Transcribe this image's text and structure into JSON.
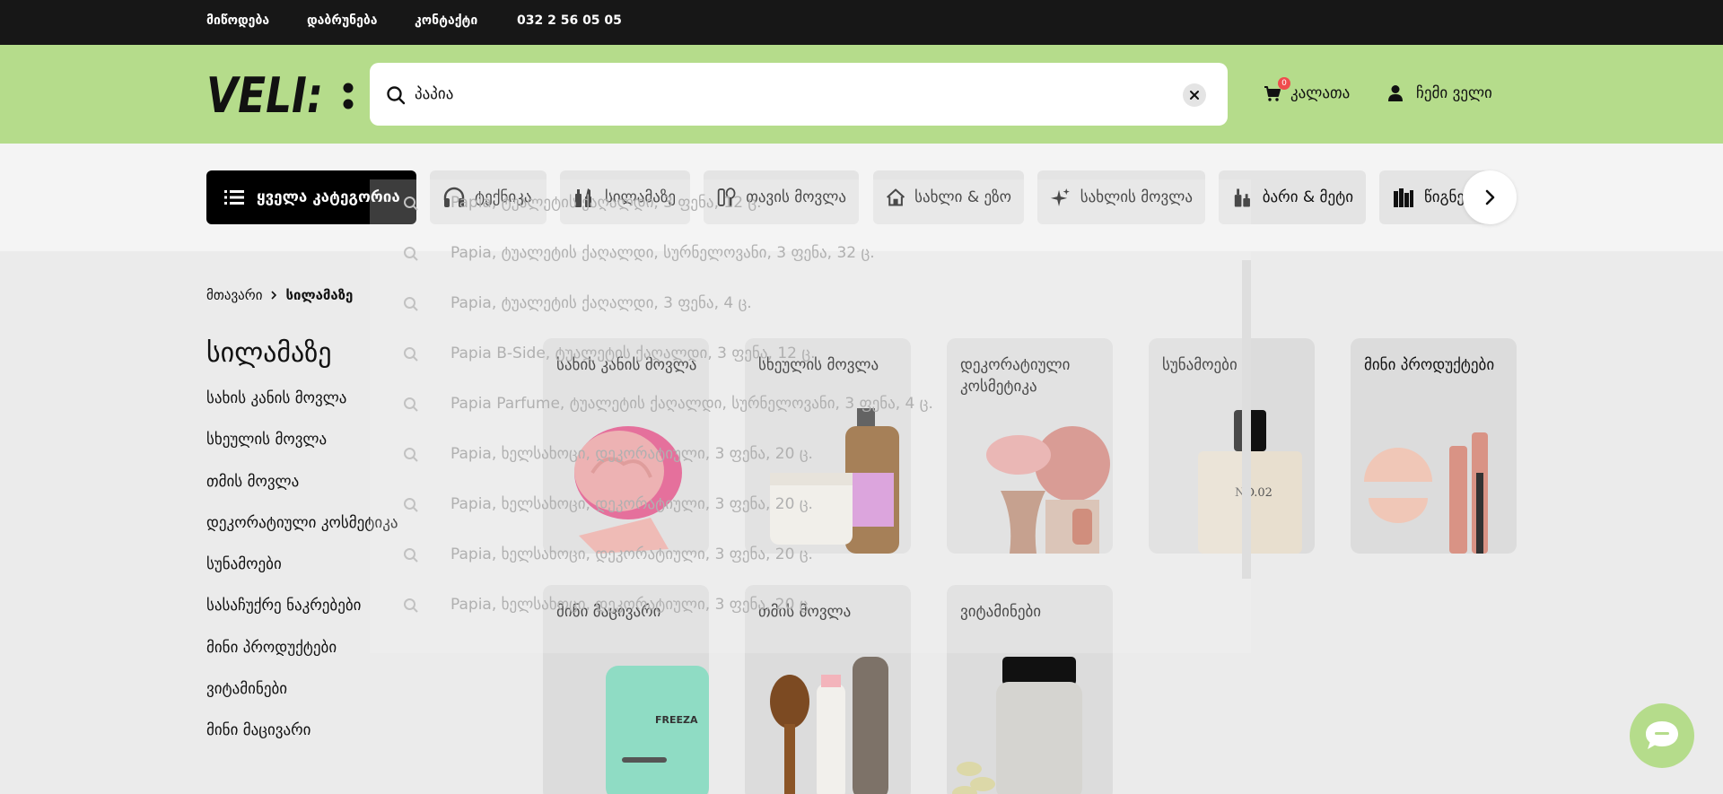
{
  "topbar": {
    "links": [
      "მიწოდება",
      "დაბრუნება",
      "კონტაქტი",
      "032 2 56 05 05"
    ]
  },
  "header": {
    "logo_text": "VELI:",
    "search": {
      "value": "პაპია",
      "placeholder": ""
    },
    "cart": {
      "label": "კალათა",
      "count": "0"
    },
    "account": {
      "label": "ჩემი ველი"
    }
  },
  "categories": {
    "all_label": "ყველა კატეგორია",
    "items": [
      {
        "label": "ტექნიკა",
        "icon": "headphones-icon"
      },
      {
        "label": "სილამაზე",
        "icon": "cosmetics-icon"
      },
      {
        "label": "თავის მოვლა",
        "icon": "hair-care-icon"
      },
      {
        "label": "სახლი & ეზო",
        "icon": "home-icon"
      },
      {
        "label": "სახლის მოვლა",
        "icon": "sparkle-icon"
      },
      {
        "label": "ბარი & მეტი",
        "icon": "bottles-icon"
      },
      {
        "label": "წიგნები",
        "icon": "books-icon"
      }
    ]
  },
  "breadcrumb": {
    "home": "მთავარი",
    "current": "სილამაზე"
  },
  "page_title": "სილამაზე",
  "sidebar": {
    "items": [
      "სახის კანის მოვლა",
      "სხეულის მოვლა",
      "თმის მოვლა",
      "დეკორატიული კოსმეტიკა",
      "სუნამოები",
      "სასაჩუქრე ნაკრებები",
      "მინი პროდუქტები",
      "ვიტამინები",
      "მინი მაცივარი"
    ]
  },
  "cards": [
    {
      "label": "სახის კანის მოვლა"
    },
    {
      "label": "სხეულის მოვლა"
    },
    {
      "label": "დეკორატიული კოსმეტიკა"
    },
    {
      "label": "სუნამოები"
    },
    {
      "label": "მინი პროდუქტები"
    },
    {
      "label": "მინი მაცივარი"
    },
    {
      "label": "თმის მოვლა"
    },
    {
      "label": "ვიტამინები"
    }
  ],
  "suggestions": [
    "Papia, ტუალეტის ქაღალდი, 3 ფენა, 12 ც.",
    "Papia, ტუალეტის ქაღალდი, სურნელოვანი, 3 ფენა, 32 ც.",
    "Papia, ტუალეტის ქაღალდი, 3 ფენა, 4 ც.",
    "Papia B-Side, ტუალეტის ქაღალდი, 3 ფენა, 12 ც.",
    "Papia Parfume, ტუალეტის ქაღალდი, სურნელოვანი, 3 ფენა, 4 ც.",
    "Papia, ხელსახოცი, დეკორატიული, 3 ფენა, 20 ც.",
    "Papia, ხელსახოცი, დეკორატიული, 3 ფენა, 20 ც.",
    "Papia, ხელსახოცი, დეკორატიული, 3 ფენა, 20 ც.",
    "Papia, ხელსახოცი, დეკორატიული, 3 ფენა, 20 ც."
  ],
  "colors": {
    "accent": "#b5dc8b",
    "dark": "#171717",
    "badge": "#ef4d4d"
  }
}
